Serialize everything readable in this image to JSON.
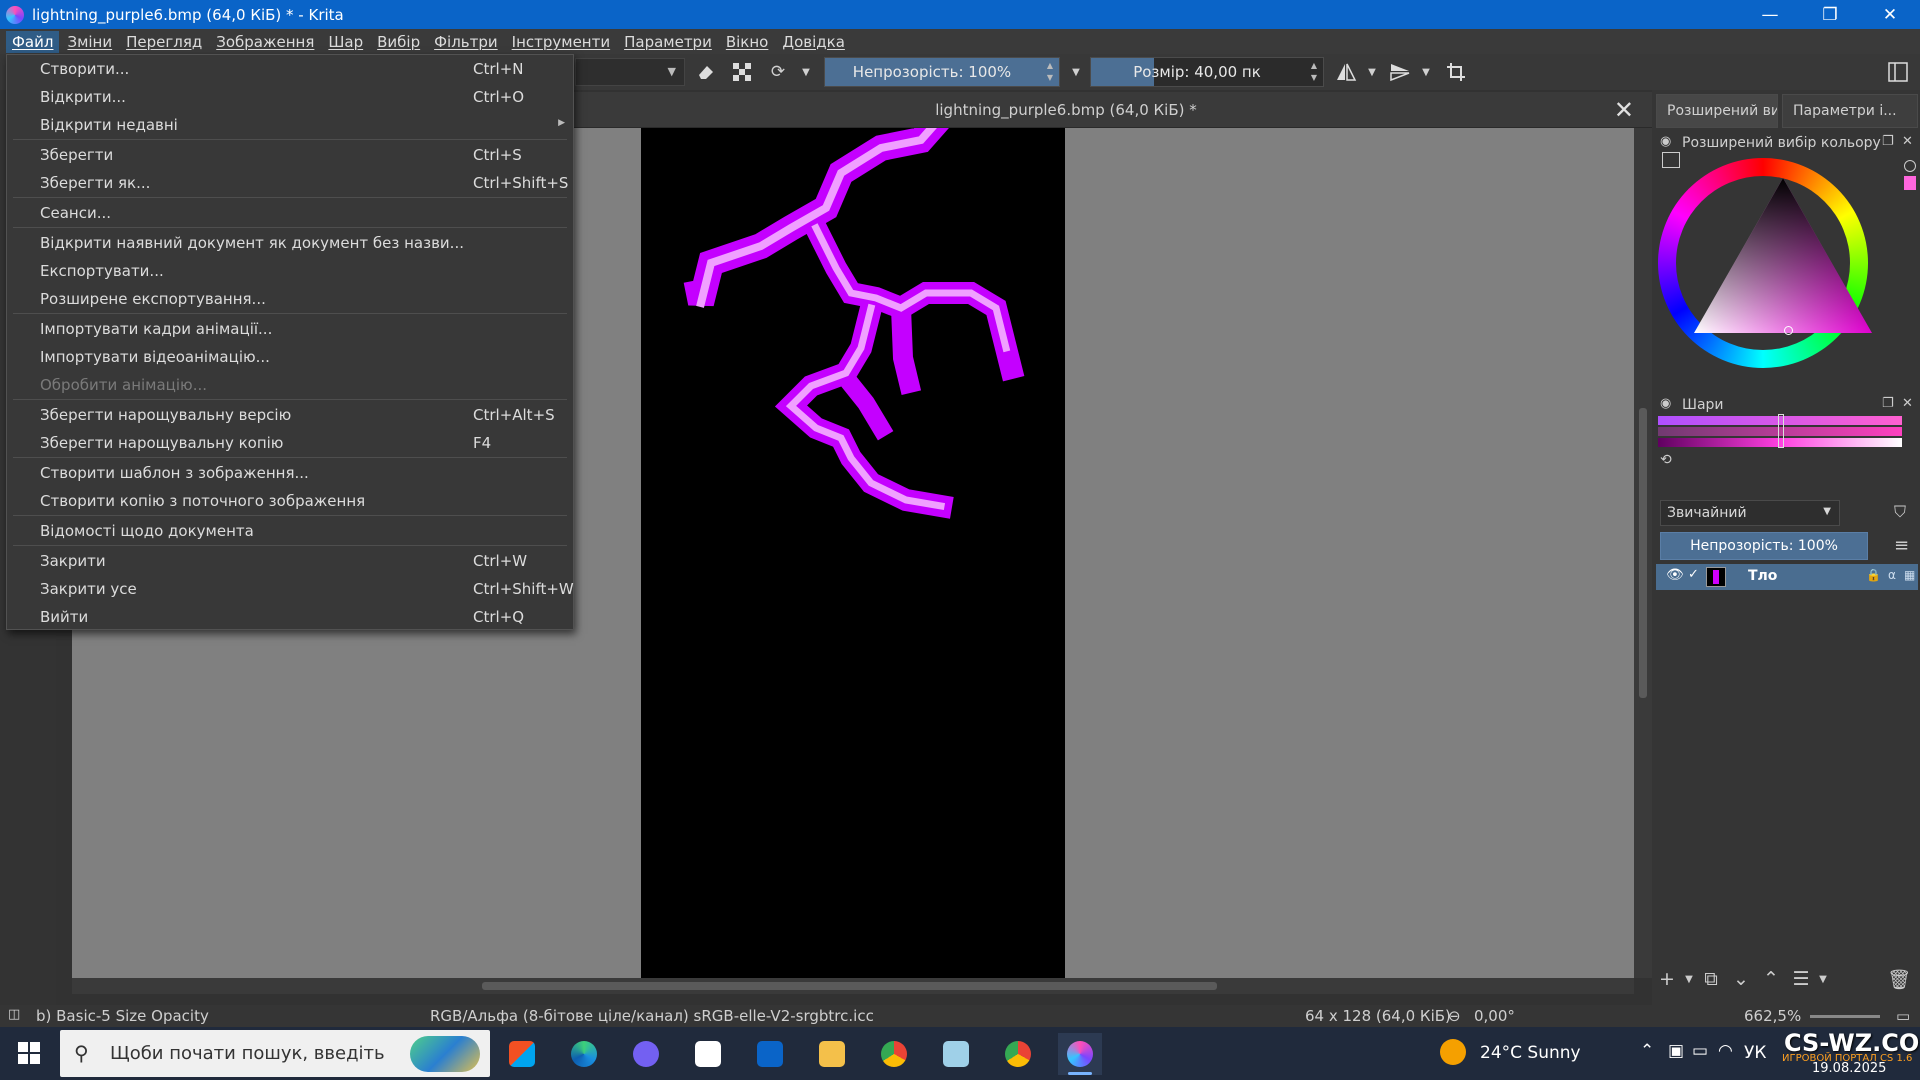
{
  "window": {
    "title": "lightning_purple6.bmp (64,0 КіБ) * - Krita",
    "controls": [
      "—",
      "❐",
      "✕"
    ]
  },
  "menubar": [
    "Файл",
    "Зміни",
    "Перегляд",
    "Зображення",
    "Шар",
    "Вибір",
    "Фільтри",
    "Інструменти",
    "Параметри",
    "Вікно",
    "Довідка"
  ],
  "toolbar": {
    "opacity_label": "Непрозорість: 100%",
    "opacity_value": 100,
    "size_label": "Розмір: 40,00 пк",
    "size_value": 40
  },
  "file_menu": {
    "items": [
      {
        "label": "Створити...",
        "shortcut": "Ctrl+N"
      },
      {
        "label": "Відкрити...",
        "shortcut": "Ctrl+O"
      },
      {
        "label": "Відкрити недавні",
        "shortcut": "",
        "submenu": true
      },
      {
        "label": "Зберегти",
        "shortcut": "Ctrl+S"
      },
      {
        "label": "Зберегти як...",
        "shortcut": "Ctrl+Shift+S"
      },
      {
        "label": "Сеанси...",
        "shortcut": ""
      },
      {
        "label": "Відкрити наявний документ як документ без назви...",
        "shortcut": ""
      },
      {
        "label": "Експортувати...",
        "shortcut": ""
      },
      {
        "label": "Розширене експортування...",
        "shortcut": ""
      },
      {
        "label": "Імпортувати кадри анімації...",
        "shortcut": ""
      },
      {
        "label": "Імпортувати відеоанімацію...",
        "shortcut": ""
      },
      {
        "label": "Обробити анімацію...",
        "shortcut": "",
        "disabled": true
      },
      {
        "label": "Зберегти нарощувальну версію",
        "shortcut": "Ctrl+Alt+S"
      },
      {
        "label": "Зберегти нарощувальну копію",
        "shortcut": "F4"
      },
      {
        "label": "Створити шаблон з зображення...",
        "shortcut": ""
      },
      {
        "label": "Створити копію з поточного зображення",
        "shortcut": ""
      },
      {
        "label": "Відомості щодо документа",
        "shortcut": ""
      },
      {
        "label": "Закрити",
        "shortcut": "Ctrl+W"
      },
      {
        "label": "Закрити усе",
        "shortcut": "Ctrl+Shift+W"
      },
      {
        "label": "Вийти",
        "shortcut": "Ctrl+Q"
      }
    ]
  },
  "canvas": {
    "tab_title": "lightning_purple6.bmp (64,0 КіБ) *",
    "close_glyph": "✕"
  },
  "docker": {
    "tabs": [
      "Розширений ви...",
      "Параметри і..."
    ],
    "color_selector_title": "Розширений вибір кольору",
    "layers_title": "Шари",
    "blend_mode": "Звичайний",
    "layer_opacity": "Непрозорість:  100%",
    "layers": [
      {
        "name": "Тло"
      }
    ]
  },
  "statusbar": {
    "preset": "b) Basic-5 Size Opacity",
    "color_space": "RGB/Альфа (8-бітове ціле/канал)  sRGB-elle-V2-srgbtrc.icc",
    "dimensions": "64 x 128 (64,0 КіБ)",
    "rotation": "0,00°",
    "zoom": "662,5%"
  },
  "taskbar": {
    "search_placeholder": "Щоби почати пошук, введіть",
    "weather": "24°C  Sunny",
    "lang": "УК",
    "date": "19.08.2025",
    "watermark": "CS-WZ.COM",
    "watermark_sub": "ИГРОВОЙ ПОРТАЛ CS 1.6"
  },
  "colors": {
    "titlebar": "#0a64c8",
    "accent": "#4c6f94",
    "lightning": "#d000ff",
    "lightning_glow": "#f0a0ff"
  }
}
